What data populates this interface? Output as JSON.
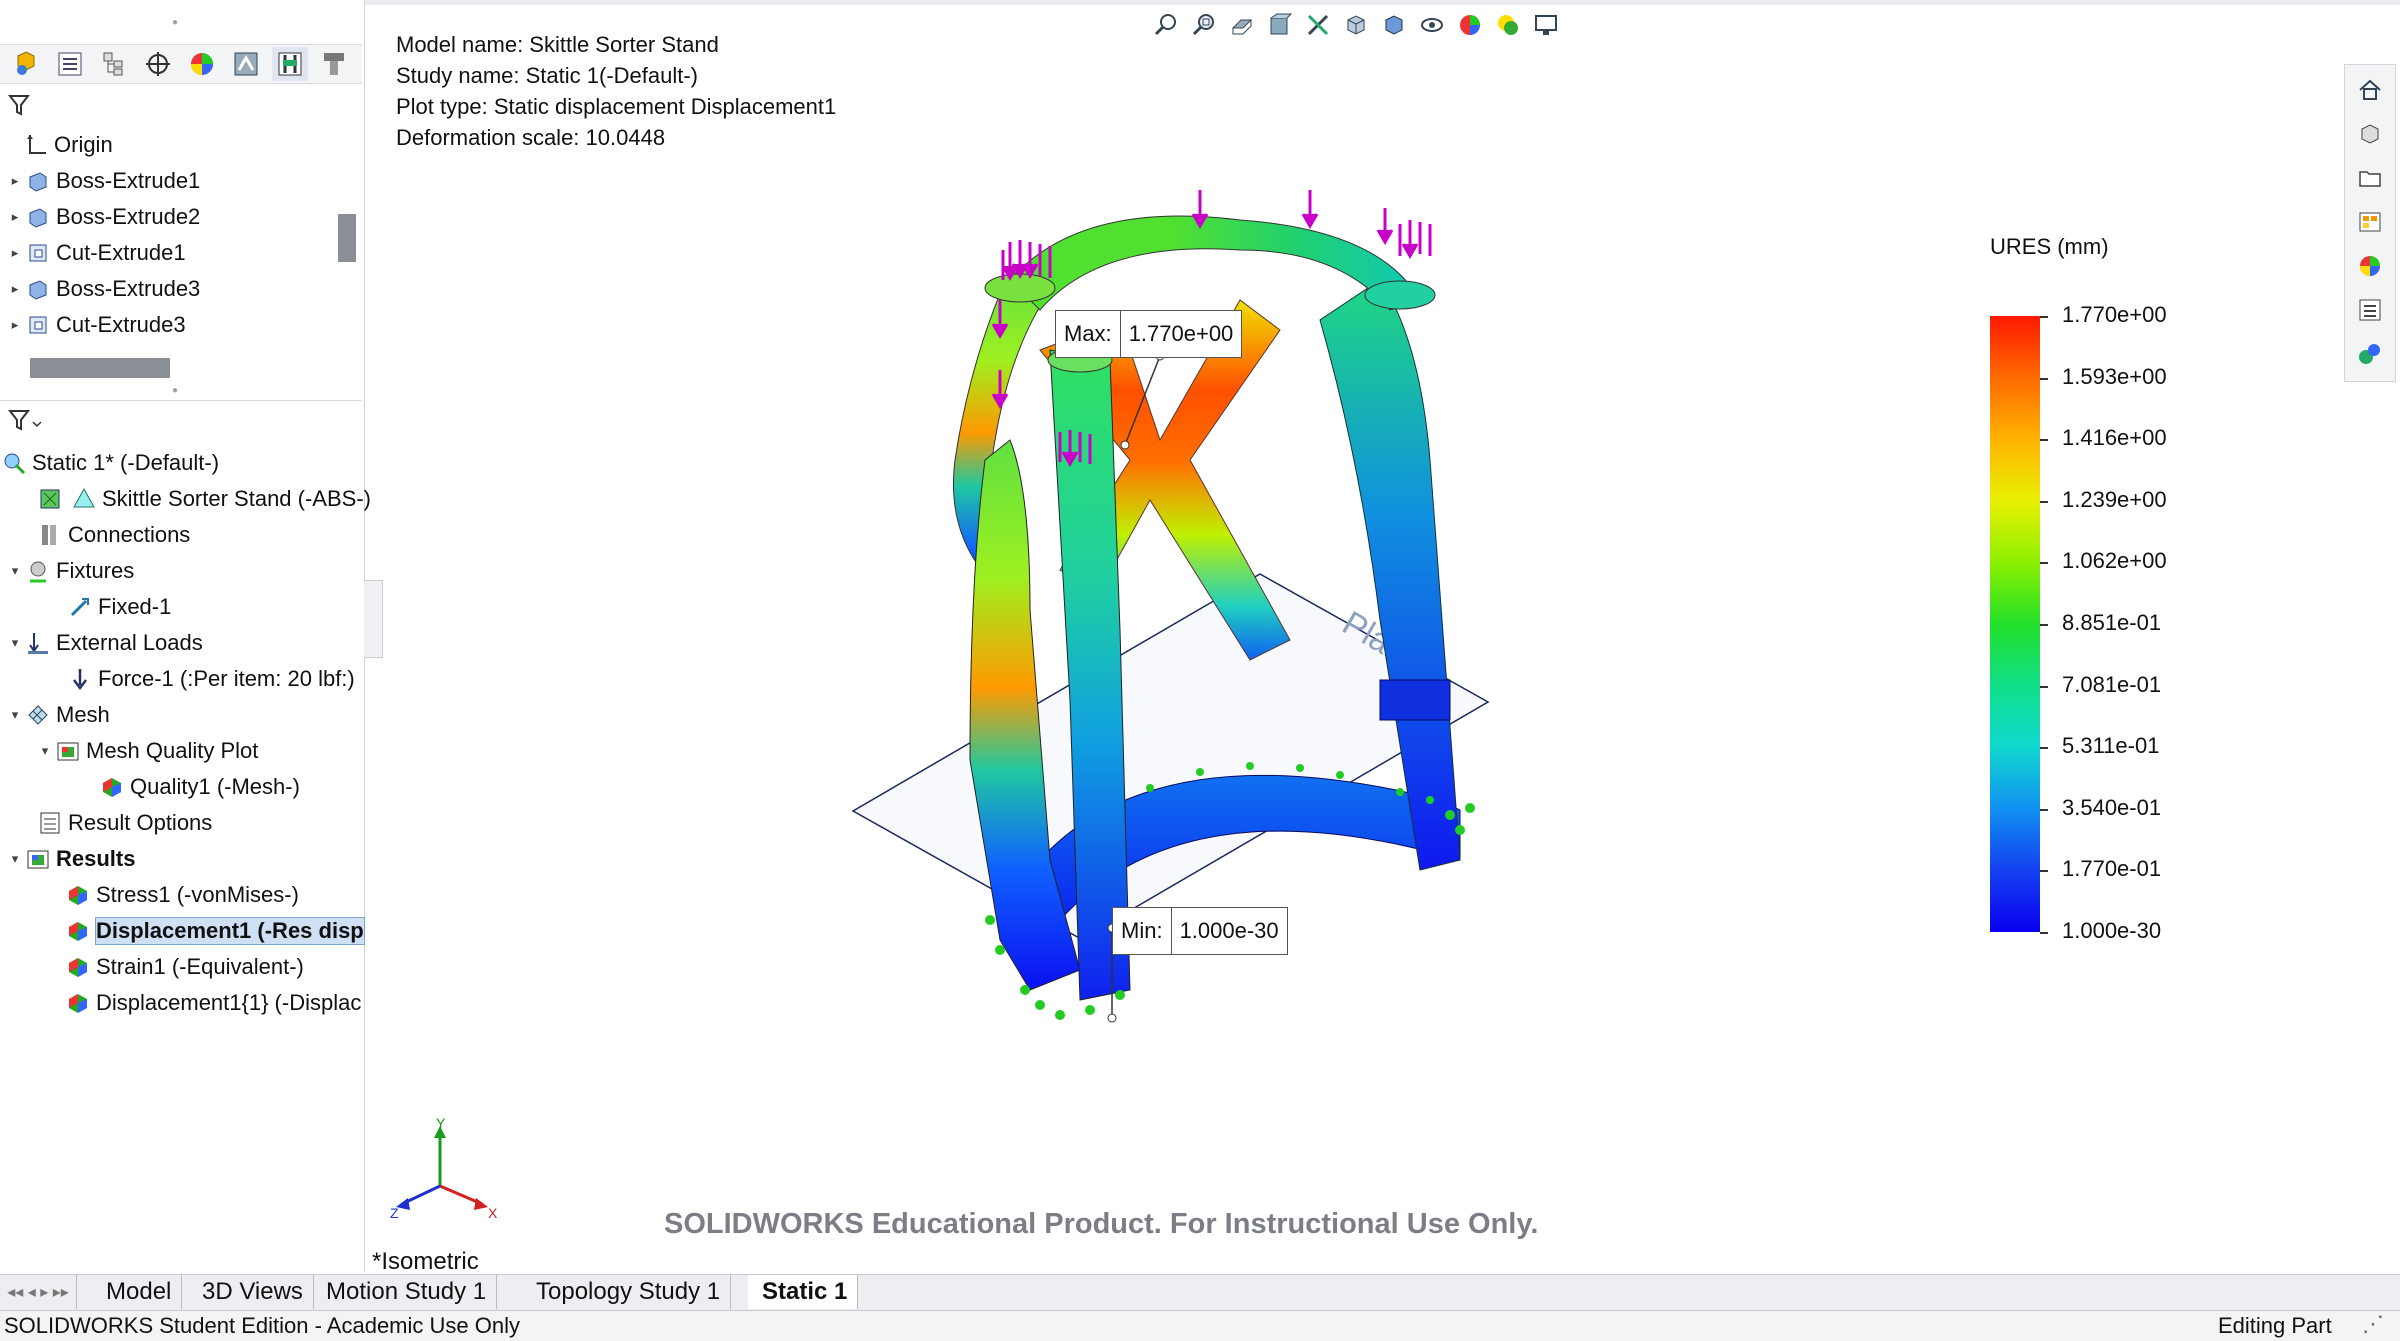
{
  "model_info": {
    "model_name": "Model name: Skittle Sorter Stand",
    "study_name": "Study name: Static 1(-Default-)",
    "plot_type": "Plot type: Static displacement Displacement1",
    "deformation_scale": "Deformation scale: 10.0448"
  },
  "feature_tree": {
    "origin": "Origin",
    "items": [
      "Boss-Extrude1",
      "Boss-Extrude2",
      "Cut-Extrude1",
      "Boss-Extrude3",
      "Cut-Extrude3"
    ]
  },
  "study_tree": {
    "study": "Static 1* (-Default-)",
    "part": "Skittle Sorter Stand (-ABS-)",
    "connections": "Connections",
    "fixtures": "Fixtures",
    "fixed": "Fixed-1",
    "external_loads": "External Loads",
    "force": "Force-1 (:Per item: 20 lbf:)",
    "mesh": "Mesh",
    "mesh_quality_plot": "Mesh Quality Plot",
    "quality": "Quality1 (-Mesh-)",
    "result_options": "Result Options",
    "results": "Results",
    "stress": "Stress1 (-vonMises-)",
    "displacement": "Displacement1 (-Res disp",
    "strain": "Strain1 (-Equivalent-)",
    "displacement2": "Displacement1{1} (-Displac"
  },
  "legend": {
    "title": "URES (mm)",
    "labels": [
      "1.770e+00",
      "1.593e+00",
      "1.416e+00",
      "1.239e+00",
      "1.062e+00",
      "8.851e-01",
      "7.081e-01",
      "5.311e-01",
      "3.540e-01",
      "1.770e-01",
      "1.000e-30"
    ]
  },
  "callouts": {
    "max_key": "Max:",
    "max_value": "1.770e+00",
    "min_key": "Min:",
    "min_value": "1.000e-30"
  },
  "plane_label": "Plane1",
  "triad": {
    "x": "X",
    "y": "Y",
    "z": "Z"
  },
  "watermark": "SOLIDWORKS Educational Product. For Instructional Use Only.",
  "view_name": "*Isometric",
  "bottom_tabs": [
    "Model",
    "3D Views",
    "Motion Study 1",
    "Topology Study 1",
    "Static 1"
  ],
  "status": {
    "left": "SOLIDWORKS Student Edition - Academic Use Only",
    "right": "Editing Part"
  },
  "icons": {
    "hud": [
      "zoom-to-fit-icon",
      "zoom-area-icon",
      "previous-view-icon",
      "section-view-icon",
      "dynamic-annotation-icon",
      "view-orientation-icon",
      "display-style-icon",
      "hide-show-icon",
      "edit-appearance-icon",
      "apply-scene-icon",
      "view-settings-icon"
    ],
    "task_pane": [
      "home-icon",
      "3d-box-icon",
      "folder-icon",
      "view-palette-icon",
      "appearances-icon",
      "custom-properties-icon",
      "simulation-icon"
    ],
    "fm_tabs": [
      "feature-manager-icon",
      "property-manager-icon",
      "configuration-manager-icon",
      "dimxpert-icon",
      "display-manager-icon",
      "cam-icon",
      "simulation-manager-icon",
      "extra-icon"
    ]
  },
  "colors": {
    "selection": "#cfe0f5",
    "legend_max": "#ff1a00",
    "legend_min": "#0a00f0",
    "load_arrow": "#c800c8",
    "fixture": "#22cc22"
  }
}
